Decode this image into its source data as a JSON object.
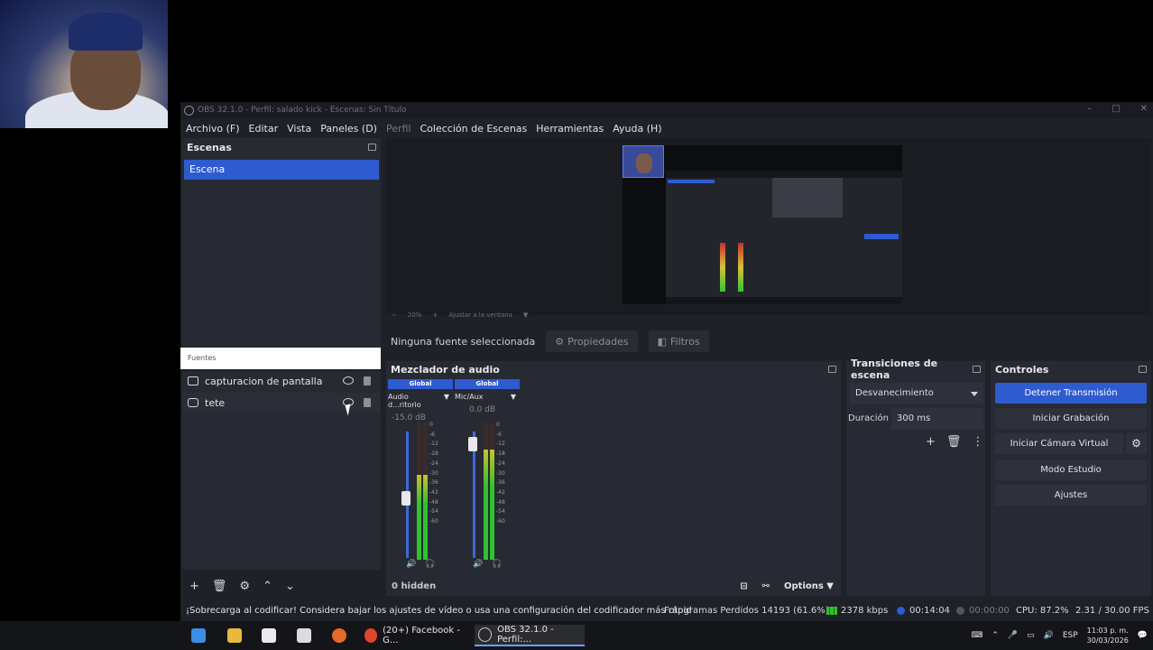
{
  "window": {
    "title": "OBS 32.1.0 - Perfil: salado kick - Escenas: Sin Título"
  },
  "menu": [
    "Archivo (F)",
    "Editar",
    "Vista",
    "Paneles (D)",
    "Perfil",
    "Colección de Escenas",
    "Herramientas",
    "Ayuda (H)"
  ],
  "scenes": {
    "title": "Escenas",
    "items": [
      "Escena"
    ]
  },
  "preview": {
    "zoom": "20%",
    "fit_label": "Ajustar a la ventana"
  },
  "source_toolbar": {
    "no_selection": "Ninguna fuente seleccionada",
    "properties": "Propiedades",
    "filters": "Filtros"
  },
  "sources": {
    "title": "Fuentes",
    "items": [
      {
        "name": "capturacion de pantalla",
        "icon": "monitor-icon"
      },
      {
        "name": "tete",
        "icon": "camera-icon"
      }
    ]
  },
  "mixer": {
    "title": "Mezclador de audio",
    "channels": [
      {
        "badge": "Global",
        "name": "Audio d...ritorio",
        "db": "-15.0 dB",
        "level": 0.62
      },
      {
        "badge": "Global",
        "name": "Mic/Aux",
        "db": "0.0 dB",
        "level": 0.8
      }
    ],
    "ticks": [
      "0",
      "-6",
      "-12",
      "-18",
      "-24",
      "-30",
      "-36",
      "-42",
      "-48",
      "-54",
      "-60"
    ],
    "hidden": "0 hidden",
    "options": "Options"
  },
  "transitions": {
    "title": "Transiciones de escena",
    "selected": "Desvanecimiento",
    "duration_label": "Duración",
    "duration_value": "300 ms"
  },
  "controls": {
    "title": "Controles",
    "stop_stream": "Detener Transmisión",
    "start_recording": "Iniciar Grabación",
    "start_virtual_cam": "Iniciar Cámara Virtual",
    "studio_mode": "Modo Estudio",
    "settings": "Ajustes"
  },
  "status": {
    "warning": "¡Sobrecarga al codificar! Considera bajar los ajustes de vídeo o usa una configuración del codificador más rápid",
    "dropped": "Fotogramas Perdidos 14193 (61.6%)",
    "bitrate": "2378 kbps",
    "stream_time": "00:14:04",
    "rec_time": "00:00:00",
    "cpu": "CPU: 87.2%",
    "fps": "2.31 / 30.00 FPS"
  },
  "taskbar": {
    "apps": [
      "(20+) Facebook - G...",
      "OBS 32.1.0 - Perfil:..."
    ],
    "language": "ESP",
    "time": "11:03 p. m.",
    "date": "30/03/2026"
  },
  "colors": {
    "accent": "#2f5bd0",
    "panel": "#272a33",
    "background": "#1f2128"
  }
}
